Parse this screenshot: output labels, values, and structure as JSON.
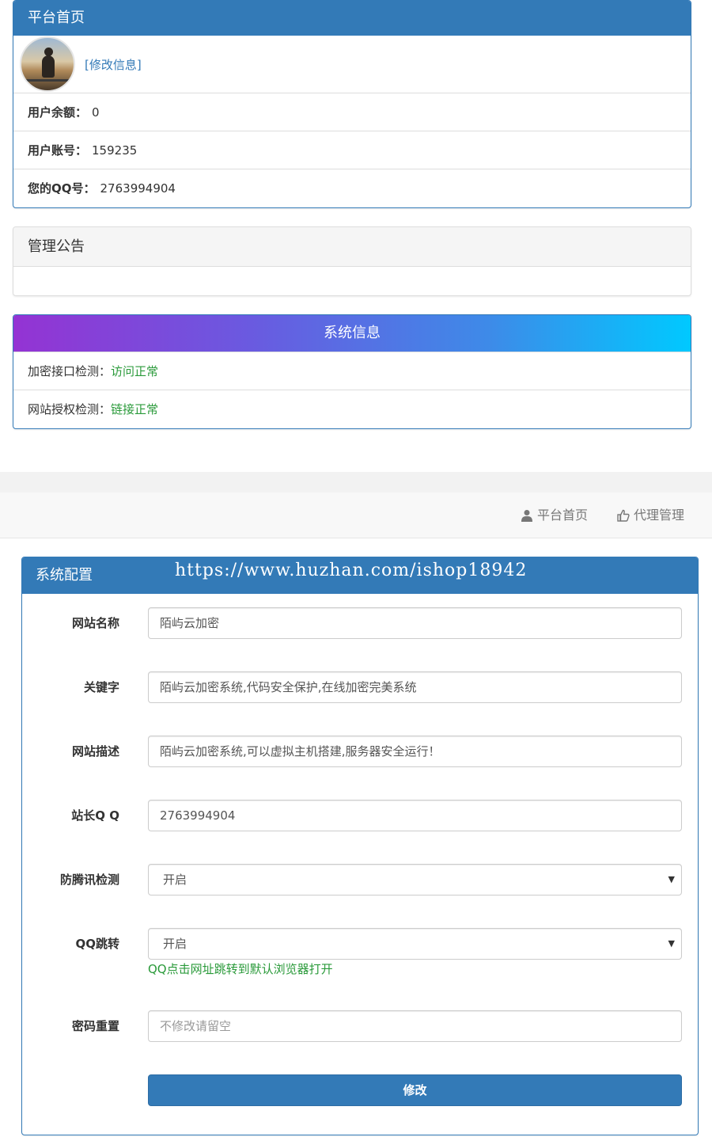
{
  "home_panel": {
    "title": "平台首页",
    "edit_link": "[修改信息]",
    "rows": [
      {
        "label": "用户余额：",
        "value": "0"
      },
      {
        "label": "用户账号：",
        "value": "159235"
      },
      {
        "label": "您的QQ号：",
        "value": "2763994904"
      }
    ]
  },
  "notice_panel": {
    "title": "管理公告"
  },
  "system_panel": {
    "title": "系统信息",
    "rows": [
      {
        "label": "加密接口检测：",
        "status": "访问正常"
      },
      {
        "label": "网站授权检测：",
        "status": "链接正常"
      }
    ]
  },
  "nav": {
    "home": "平台首页",
    "agent": "代理管理"
  },
  "config_panel": {
    "title": "系统配置",
    "watermark": "https://www.huzhan.com/ishop18942",
    "fields": {
      "site_name": {
        "label": "网站名称",
        "value": "陌屿云加密"
      },
      "keywords": {
        "label": "关键字",
        "value": "陌屿云加密系统,代码安全保护,在线加密完美系统"
      },
      "description": {
        "label": "网站描述",
        "value": "陌屿云加密系统,可以虚拟主机搭建,服务器安全运行！"
      },
      "admin_qq": {
        "label": "站长Q Q",
        "value": "2763994904"
      },
      "anti_tencent": {
        "label": "防腾讯检测",
        "value": "开启"
      },
      "qq_jump": {
        "label": "QQ跳转",
        "value": "开启",
        "help": "QQ点击网址跳转到默认浏览器打开"
      },
      "password_reset": {
        "label": "密码重置",
        "placeholder": "不修改请留空"
      }
    },
    "submit_label": "修改"
  },
  "colors": {
    "primary": "#337ab7",
    "success_text": "#2a9a3a",
    "gradient_start": "#9433d3",
    "gradient_end": "#00c9ff"
  }
}
